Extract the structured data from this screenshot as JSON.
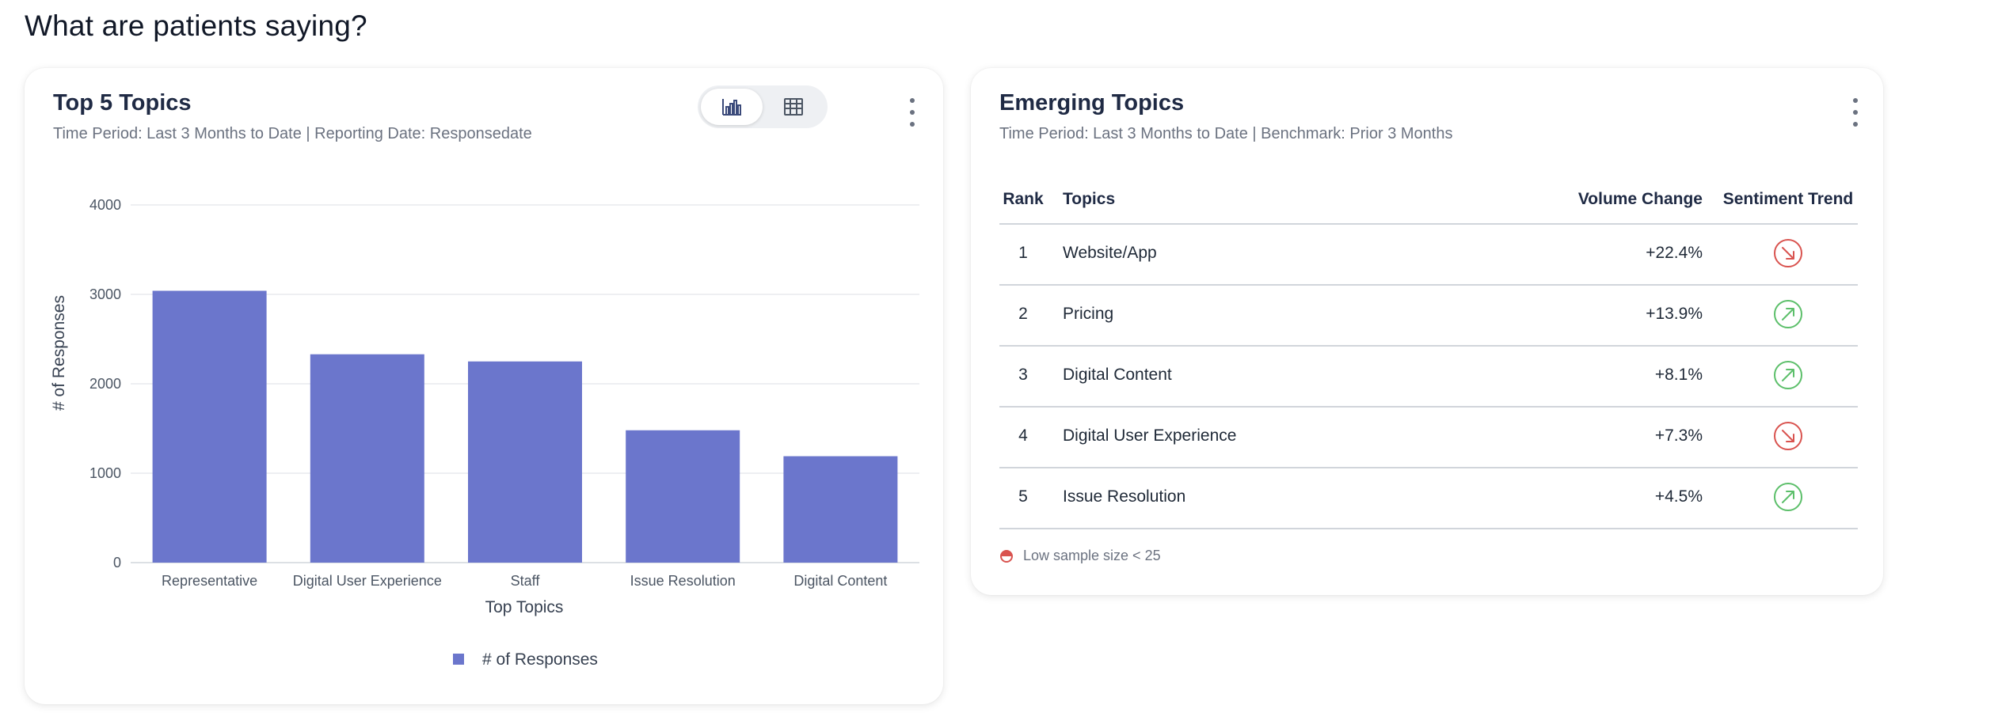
{
  "page": {
    "title": "What are patients saying?"
  },
  "top_topics": {
    "title": "Top 5 Topics",
    "subtitle": "Time Period: Last 3 Months to Date | Reporting Date: Responsedate",
    "view_toggle": {
      "chart_icon": "bar-chart-icon",
      "table_icon": "table-icon",
      "active": "chart"
    },
    "menu_icon": "kebab-menu-icon"
  },
  "chart_data": {
    "type": "bar",
    "categories": [
      "Representative",
      "Digital User Experience",
      "Staff",
      "Issue Resolution",
      "Digital Content"
    ],
    "series": [
      {
        "name": "# of Responses",
        "values": [
          3040,
          2330,
          2250,
          1480,
          1190
        ],
        "color": "#6b76cc"
      }
    ],
    "xlabel": "Top Topics",
    "ylabel": "# of Responses",
    "ylim": [
      0,
      4000
    ],
    "yticks": [
      "0",
      "1000",
      "2000",
      "3000",
      "4000"
    ],
    "grid": true,
    "legend": "bottom"
  },
  "emerging": {
    "title": "Emerging Topics",
    "subtitle": "Time Period: Last 3 Months to Date | Benchmark: Prior 3 Months",
    "menu_icon": "kebab-menu-icon",
    "columns": {
      "rank": "Rank",
      "topics": "Topics",
      "volume": "Volume Change",
      "trend": "Sentiment Trend"
    },
    "rows": [
      {
        "rank": "1",
        "topic": "Website/App",
        "volume": "+22.4%",
        "trend": "down"
      },
      {
        "rank": "2",
        "topic": "Pricing",
        "volume": "+13.9%",
        "trend": "up"
      },
      {
        "rank": "3",
        "topic": "Digital Content",
        "volume": "+8.1%",
        "trend": "up"
      },
      {
        "rank": "4",
        "topic": "Digital User Experience",
        "volume": "+7.3%",
        "trend": "down"
      },
      {
        "rank": "5",
        "topic": "Issue Resolution",
        "volume": "+4.5%",
        "trend": "up"
      }
    ],
    "footnote": "Low sample size < 25",
    "colors": {
      "up": "#5cbf6a",
      "down": "#d9534f"
    }
  }
}
